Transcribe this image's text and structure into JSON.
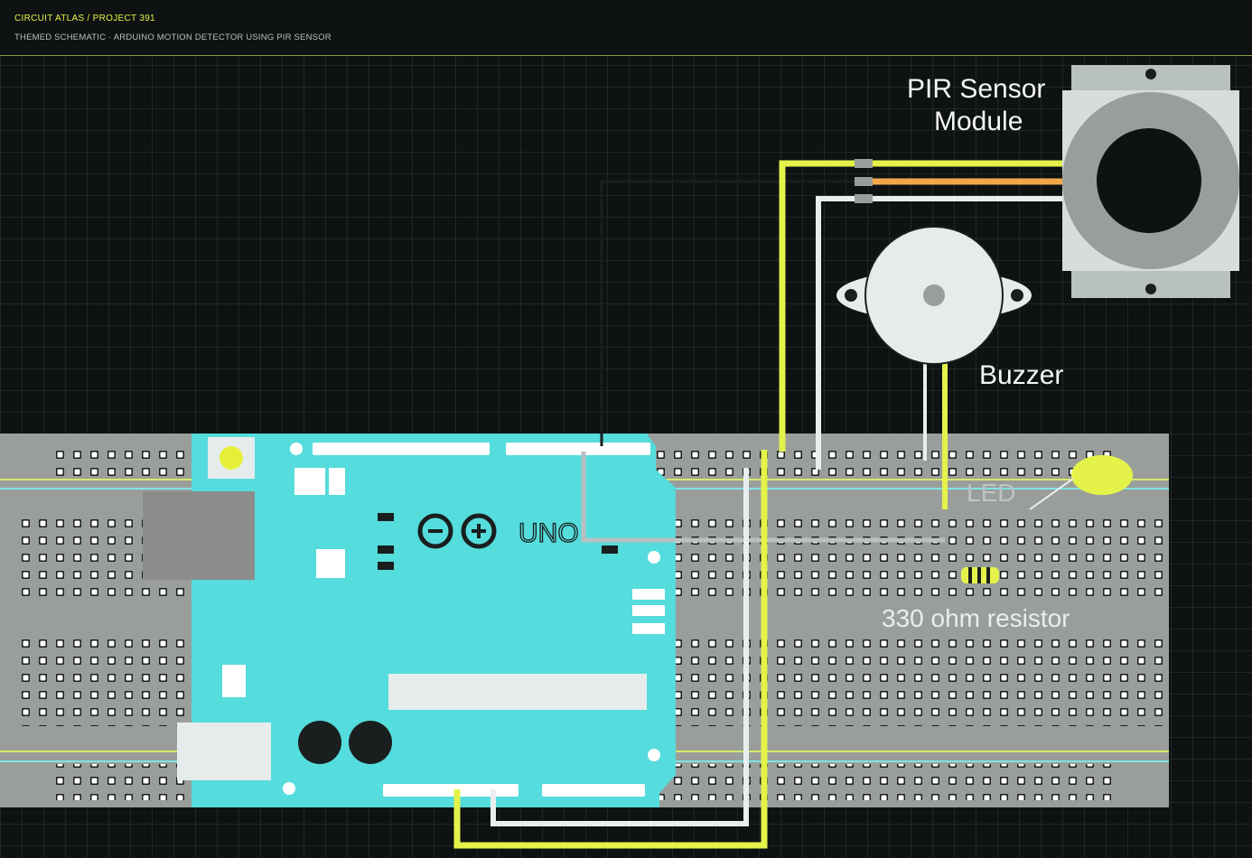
{
  "header": {
    "breadcrumb": "CIRCUIT ATLAS / PROJECT 391",
    "subtitle": "THEMED SCHEMATIC · ARDUINO MOTION DETECTOR USING PIR SENSOR"
  },
  "components": {
    "pir_label_line1": "PIR Sensor",
    "pir_label_line2": "Module",
    "buzzer_label": "Buzzer",
    "led_label": "LED",
    "resistor_label": "330 ohm resistor",
    "board_logo_text": "UNO"
  },
  "colors": {
    "background": "#0e1212",
    "breadboard": "#9a9e9a",
    "board": "#55dcdc",
    "wire_yellow": "#e4f24a",
    "wire_orange": "#f4a64a",
    "wire_white": "#e8eeee",
    "rail_line": "#d8e86a",
    "rail_cyan": "#7ee4e4",
    "accent": "#e8f24a"
  }
}
